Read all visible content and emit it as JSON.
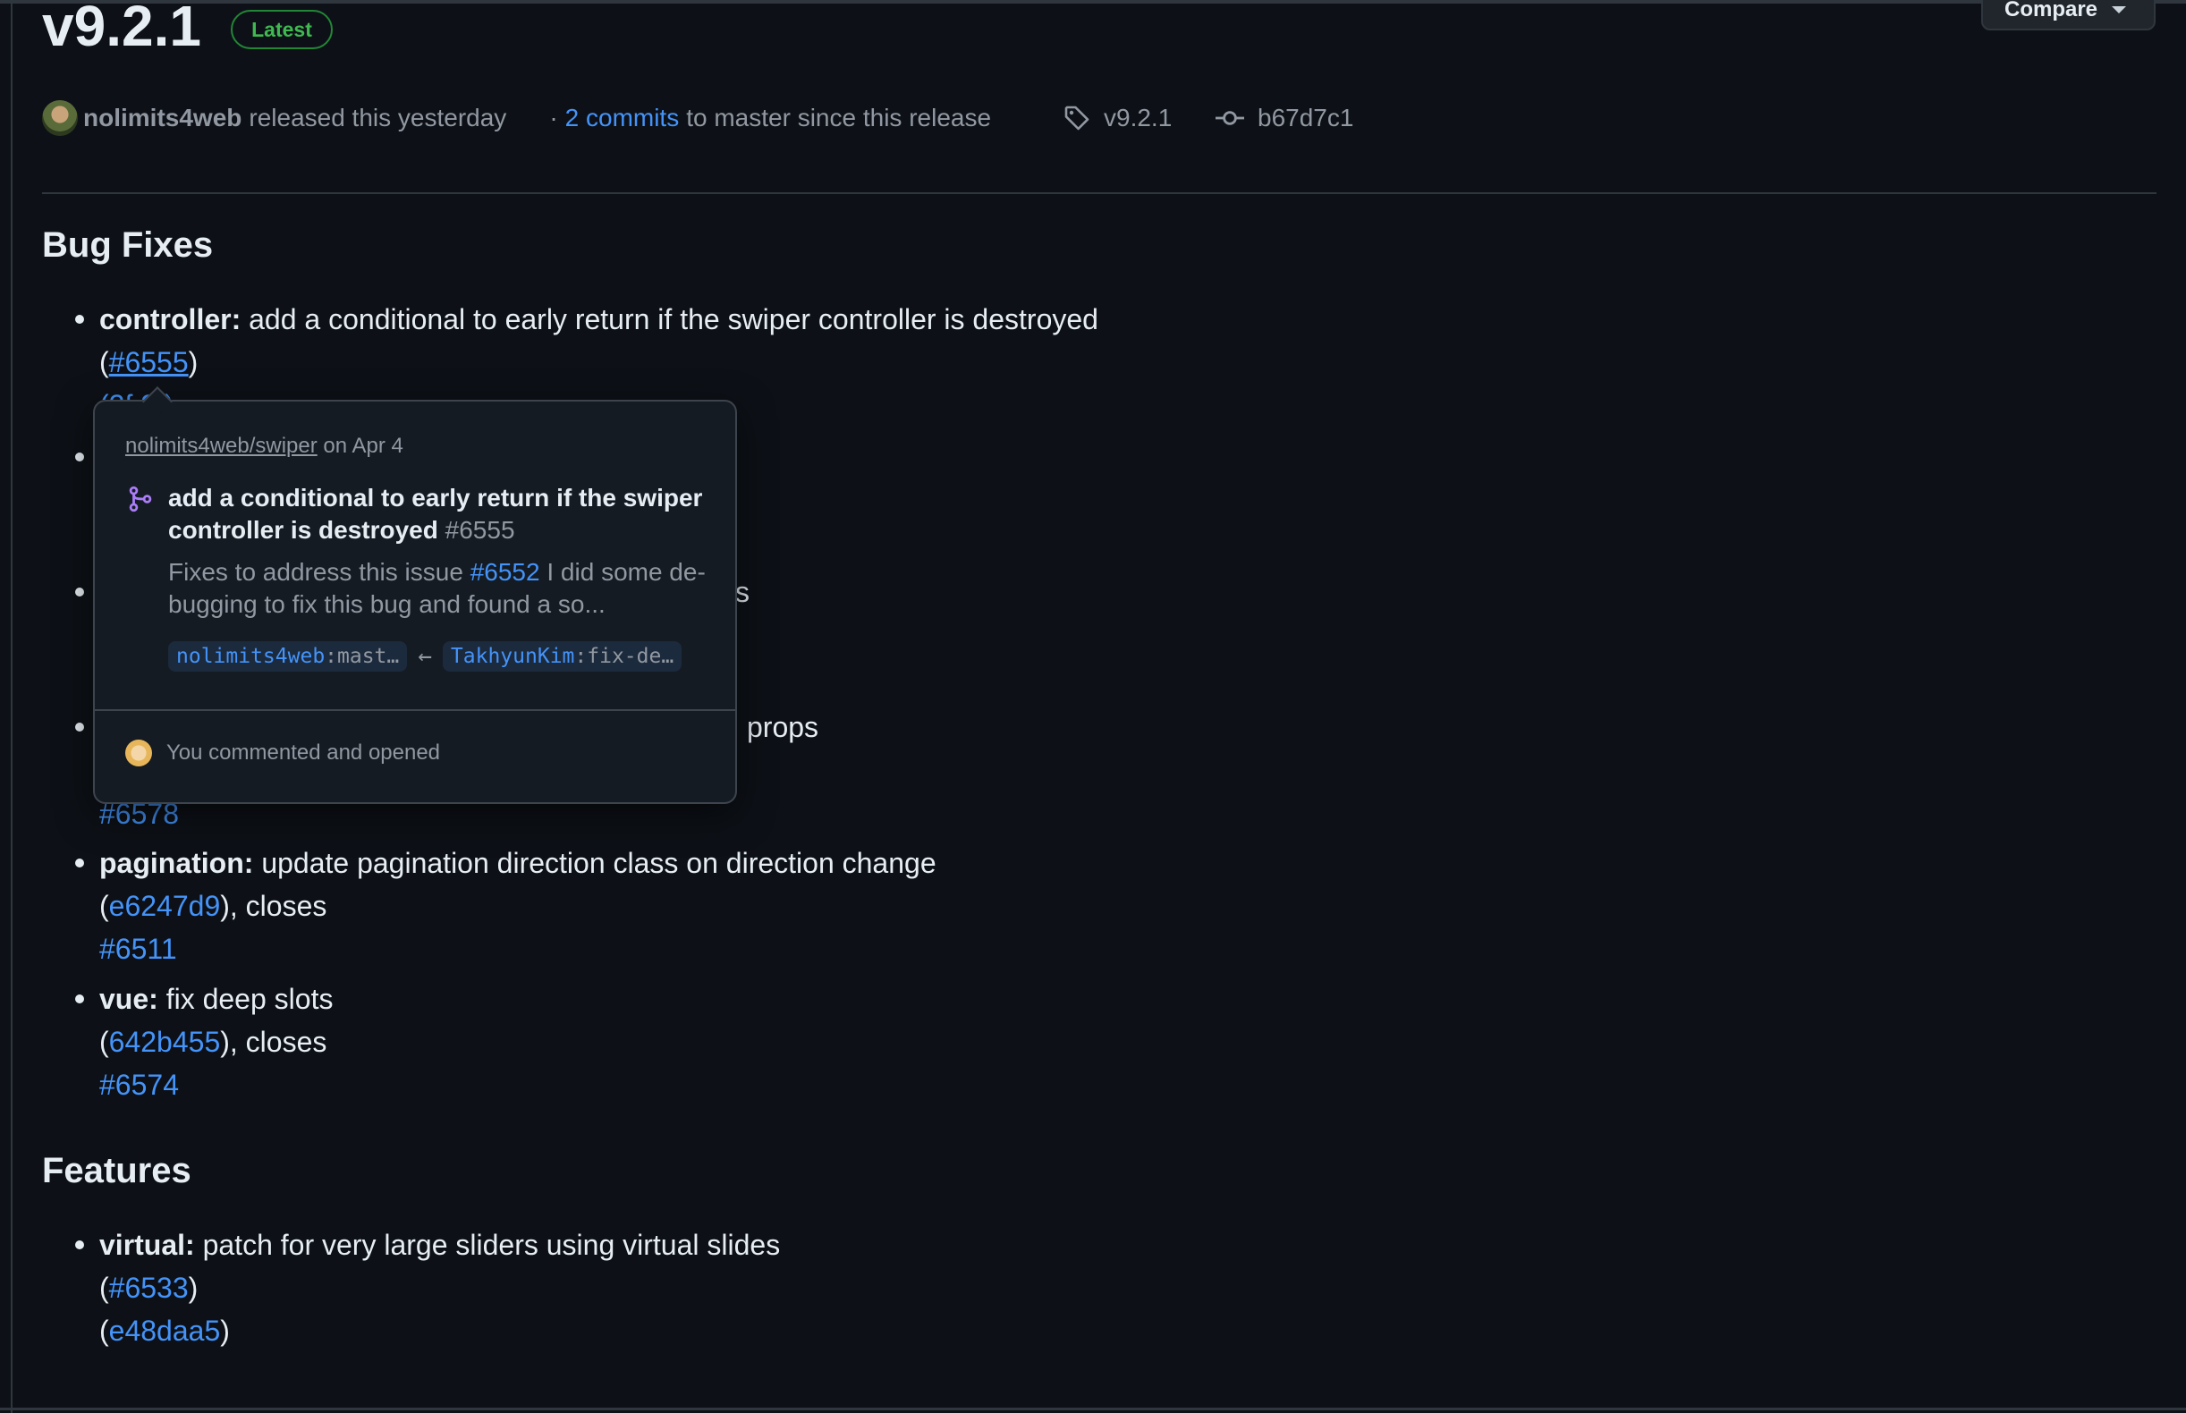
{
  "release": {
    "title": "v9.2.1",
    "badge": "Latest",
    "compare_label": "Compare"
  },
  "meta": {
    "author": "nolimits4web",
    "released_text": "released this yesterday",
    "dot": "·",
    "commits_link": "2 commits",
    "commits_suffix": "to master since this release",
    "tag": "v9.2.1",
    "commit_sha": "b67d7c1"
  },
  "sections": {
    "bug_fixes": {
      "heading": "Bug Fixes",
      "items": [
        {
          "scope": "controller:",
          "text": "add a conditional to early return if the swiper controller is destroyed",
          "pr": "#6555",
          "partial_line": "(2f    9  )"
        },
        {
          "trailing_partial": "s"
        },
        {
          "trailing_text": "props",
          "link": "#6578"
        },
        {
          "scope": "pagination:",
          "text": "update pagination direction class on direction change",
          "commit": "e6247d9",
          "closes": ", closes",
          "issue": "#6511"
        },
        {
          "scope": "vue:",
          "text": "fix deep slots",
          "commit": "642b455",
          "closes": ", closes",
          "issue": "#6574"
        }
      ]
    },
    "features": {
      "heading": "Features",
      "items": [
        {
          "scope": "virtual:",
          "text": "patch for very large sliders using virtual slides",
          "pr": "#6533",
          "commit": "e48daa5"
        }
      ]
    }
  },
  "popover": {
    "repo": "nolimits4web/swiper",
    "date": "on Apr 4",
    "title": "add a conditional to early return if the swiper controller is destroyed",
    "number": "#6555",
    "body_prefix": "Fixes to address this issue",
    "body_issue": "#6552",
    "body_suffix": "I did some de-bugging to fix this bug and found a so...",
    "base_owner": "nolimits4web",
    "base_branch": ":mast…",
    "head_owner": "TakhyunKim",
    "head_branch": ":fix-de…",
    "arrow": "←",
    "footer": "You commented and opened"
  },
  "colors": {
    "background": "#0d1117",
    "text": "#e6edf3",
    "muted": "#9198a1",
    "link": "#4493f8",
    "badge_green": "#3fb950",
    "pr_purple": "#ab7df8"
  },
  "icons": {
    "tag": "tag-icon",
    "commit": "git-commit-icon",
    "pr": "git-merge-icon",
    "caret": "caret-down-icon"
  }
}
